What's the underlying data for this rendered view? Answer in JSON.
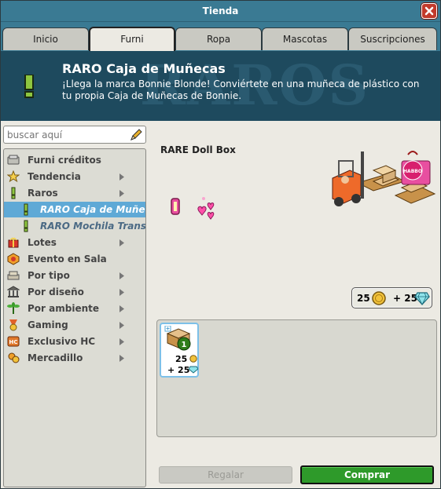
{
  "window": {
    "title": "Tienda",
    "close_label": "×"
  },
  "tabs": [
    {
      "label": "Inicio"
    },
    {
      "label": "Furni"
    },
    {
      "label": "Ropa"
    },
    {
      "label": "Mascotas"
    },
    {
      "label": "Suscripciones"
    }
  ],
  "active_tab": "Furni",
  "banner": {
    "title": "RARO Caja de Muñecas",
    "description": "¡Llega la marca Bonnie Blonde! Conviértete en una muñeca de plástico con tu propia Caja de Muñecas de Bonnie.",
    "watermark": "RAROS"
  },
  "search": {
    "placeholder": "buscar aquí",
    "value": ""
  },
  "sidebar": {
    "items": [
      {
        "label": "Furni créditos",
        "icon": "furni-credits-icon",
        "has_arrow": false
      },
      {
        "label": "Tendencia",
        "icon": "star-icon",
        "has_arrow": true
      },
      {
        "label": "Raros",
        "icon": "exclamation-icon",
        "has_arrow": true
      },
      {
        "label": "RARO Caja de Muñecas",
        "icon": "exclamation-icon",
        "has_arrow": false,
        "sub": true,
        "selected": true
      },
      {
        "label": "RARO Mochila Transpar",
        "icon": "exclamation-icon",
        "has_arrow": false,
        "sub": true
      },
      {
        "label": "Lotes",
        "icon": "gift-box-icon",
        "has_arrow": true
      },
      {
        "label": "Evento en Sala",
        "icon": "event-icon",
        "has_arrow": false
      },
      {
        "label": "Por tipo",
        "icon": "sofa-icon",
        "has_arrow": true
      },
      {
        "label": "Por diseño",
        "icon": "columns-icon",
        "has_arrow": true
      },
      {
        "label": "Por ambiente",
        "icon": "plant-icon",
        "has_arrow": true
      },
      {
        "label": "Gaming",
        "icon": "medal-icon",
        "has_arrow": true
      },
      {
        "label": "Exclusivo HC",
        "icon": "hc-icon",
        "has_arrow": true
      },
      {
        "label": "Mercadillo",
        "icon": "market-icon",
        "has_arrow": true
      }
    ]
  },
  "product": {
    "title": "RARE Doll Box",
    "price_credits": "25",
    "price_plus": "+ 25",
    "credit_icon": "coin-icon",
    "diamond_icon": "diamond-icon",
    "habbo_badge": "HABBO"
  },
  "grid": {
    "items": [
      {
        "credits": "25",
        "diamonds": "+ 25",
        "badge": "1"
      }
    ]
  },
  "buttons": {
    "gift": "Regalar",
    "buy": "Comprar"
  },
  "colors": {
    "titlebar": "#3a7a93",
    "banner": "#1e4a5e",
    "selected": "#5fa9d6",
    "buy": "#2e9a2a"
  }
}
